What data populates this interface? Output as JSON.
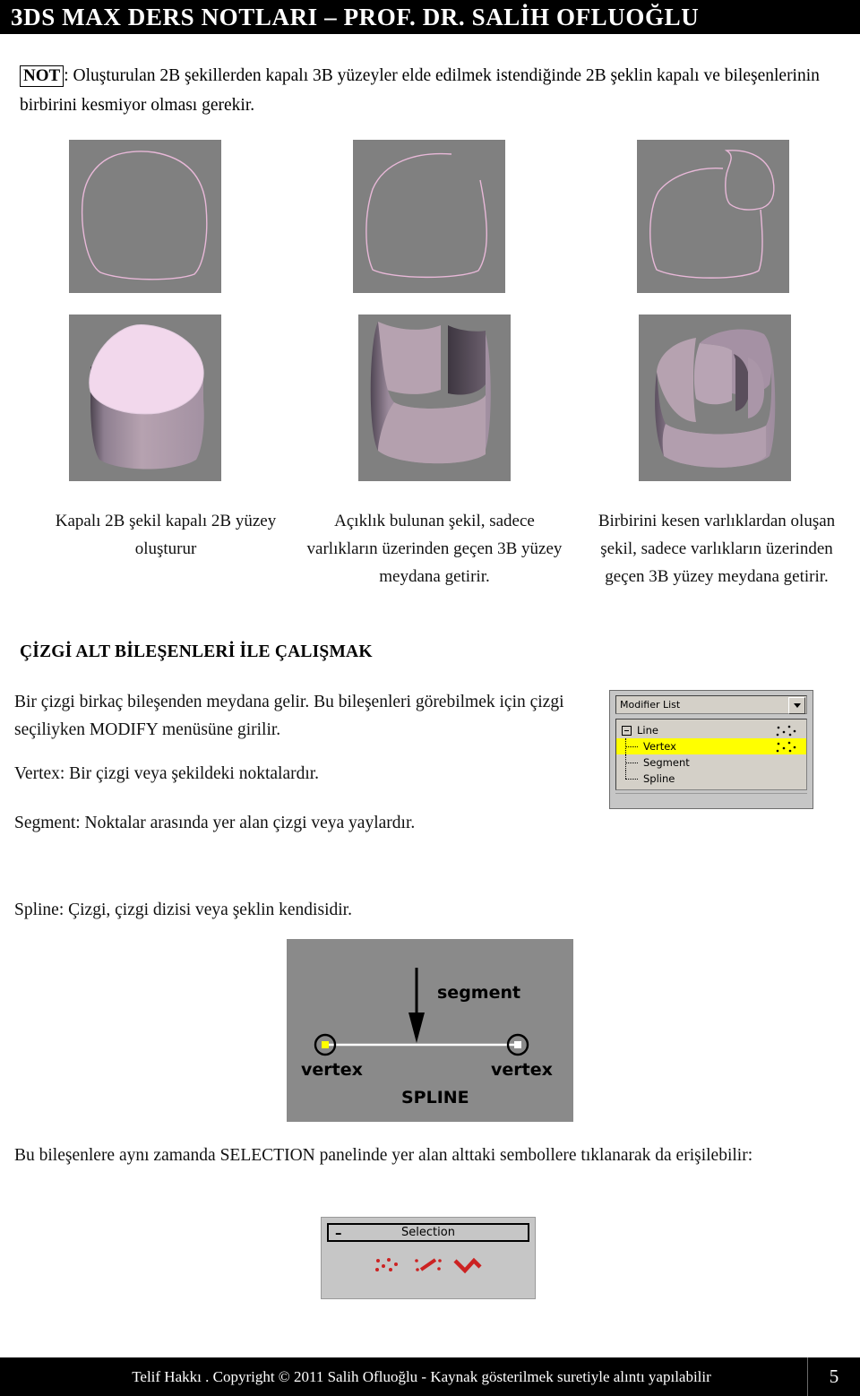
{
  "header": {
    "title": "3DS MAX DERS NOTLARI – PROF. DR. SALİH OFLUOĞLU"
  },
  "note": {
    "tag": "NOT",
    "text": ": Oluşturulan 2B şekillerden kapalı 3B yüzeyler elde edilmek istendiğinde 2B şeklin kapalı ve bileşenlerinin birbirini kesmiyor olması gerekir."
  },
  "figure_captions": [
    "Kapalı 2B şekil kapalı 2B yüzey oluşturur",
    "Açıklık bulunan şekil, sadece varlıkların üzerinden geçen 3B yüzey meydana getirir.",
    "Birbirini kesen varlıklardan oluşan şekil, sadece varlıkların üzerinden geçen 3B yüzey meydana getirir."
  ],
  "section_heading": "ÇİZGİ ALT BİLEŞENLERİ İLE ÇALIŞMAK",
  "paragraphs": {
    "intro": "Bir çizgi birkaç bileşenden meydana gelir. Bu bileşenleri görebilmek için çizgi seçiliyken MODIFY menüsüne girilir.",
    "vertex": "Vertex: Bir çizgi veya şekildeki noktalardır.",
    "segment": "Segment: Noktalar arasında yer alan çizgi veya yaylardır.",
    "spline": "Spline: Çizgi, çizgi dizisi veya şeklin kendisidir.",
    "selection_note": "Bu bileşenlere aynı zamanda SELECTION panelinde yer alan alttaki sembollere tıklanarak da erişilebilir:"
  },
  "modifier_panel": {
    "combo_label": "Modifier List",
    "stack": [
      {
        "label": "Line",
        "selected": false,
        "has_dots": true
      },
      {
        "label": "Vertex",
        "selected": true,
        "has_dots": true
      },
      {
        "label": "Segment",
        "selected": false,
        "has_dots": false
      },
      {
        "label": "Spline",
        "selected": false,
        "has_dots": false
      }
    ],
    "highlight_color": "#ffff00"
  },
  "spline_diagram": {
    "segment_label": "segment",
    "vertex_left_label": "vertex",
    "vertex_right_label": "vertex",
    "spline_label": "SPLINE",
    "background_color": "#8a8a8a",
    "left_vertex_color": "#ffff00",
    "right_vertex_color": "#ffffff"
  },
  "selection_panel": {
    "minus": "–",
    "title": "Selection",
    "icon_color": "#cc2222",
    "icons": [
      "vertex-icon",
      "segment-icon",
      "spline-icon"
    ]
  },
  "footer": {
    "text": "Telif Hakkı . Copyright © 2011 Salih Ofluoğlu - Kaynak gösterilmek suretiyle alıntı yapılabilir",
    "page": "5"
  },
  "viewport_colors": {
    "background": "#808080",
    "spline_stroke": "#e8b8d8",
    "surface_light": "#f2d8ec",
    "surface_mid": "#b09aa8",
    "surface_dark": "#6f6070"
  }
}
